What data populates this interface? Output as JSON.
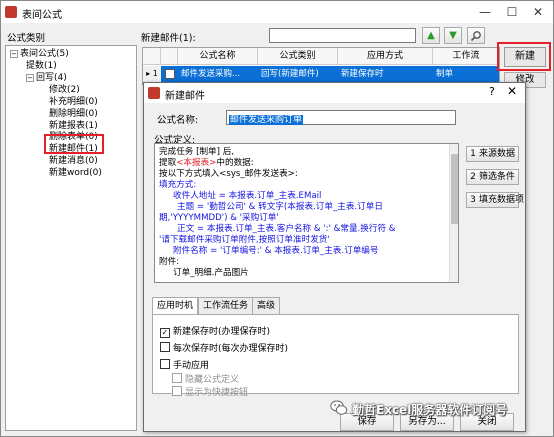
{
  "app": {
    "title": "表间公式"
  },
  "left": {
    "category_label": "公式类别",
    "tree": [
      {
        "label": "表间公式(5)",
        "level": 0,
        "expanded": true
      },
      {
        "label": "提数(1)",
        "level": 1
      },
      {
        "label": "回写(4)",
        "level": 1,
        "expanded": true
      },
      {
        "label": "修改(2)",
        "level": 2
      },
      {
        "label": "补充明细(0)",
        "level": 2
      },
      {
        "label": "删除明细(0)",
        "level": 2
      },
      {
        "label": "新建报表(1)",
        "level": 2
      },
      {
        "label": "删除表单(0)",
        "level": 2
      },
      {
        "label": "新建邮件(1)",
        "level": 2,
        "selected": true
      },
      {
        "label": "新建消息(0)",
        "level": 2
      },
      {
        "label": "新建word(0)",
        "level": 2
      }
    ]
  },
  "top": {
    "list_label": "新建邮件(1):",
    "search": {
      "value": "",
      "placeholder": ""
    },
    "up_icon": "arrow-up-icon",
    "down_icon": "arrow-down-icon",
    "find_icon": "magnifier-icon"
  },
  "grid": {
    "columns": [
      "公式名称",
      "公式类别",
      "应用方式",
      "工作流"
    ],
    "rows": [
      {
        "indicator": "▸ 1",
        "name": "邮件发送采购...",
        "category": "回写(新建邮件)",
        "apply": "新建保存时",
        "workflow": "制单"
      }
    ]
  },
  "buttons": {
    "new": "新建",
    "edit": "修改"
  },
  "dialog": {
    "title": "新建邮件",
    "help": "?",
    "close": "✕",
    "name_label": "公式名称:",
    "name_value": "邮件发送采购订单",
    "def_label": "公式定义:",
    "definition": {
      "l1": "完成任务 [制单] 后,",
      "l2_a": "提取",
      "l2_b": "<本报表>",
      "l2_c": "中的数据:",
      "l3": "按以下方式填入<sys_邮件发送表>:",
      "l4": "填充方式:",
      "l5": "收件人地址 = 本报表.订单_主表.EMail",
      "l6": "主题 = '勤哲公司' & 转文字(本报表.订单_主表.订单日",
      "l7": "期,'YYYYMMDD') & '采购订单'",
      "l8": "正文 = 本报表.订单_主表.客户名称 & ':' &常量.换行符 &",
      "l9": "'请下载邮件采购订单附件,按照订单准时发货'",
      "l10": "附件名称 = '订单编号:' & 本报表.订单_主表.订单编号",
      "l11": "附件:",
      "l12": "订单_明细.产品图片"
    },
    "side_buttons": [
      {
        "num": "1",
        "label": "来源数据"
      },
      {
        "num": "2",
        "label": "筛选条件"
      },
      {
        "num": "3",
        "label": "填充数据项"
      }
    ],
    "tabs": [
      "应用时机",
      "工作流任务",
      "高级"
    ],
    "options": {
      "new_save": {
        "label": "新建保存时(办理保存时)",
        "checked": true
      },
      "every_save": {
        "label": "每次保存时(每次办理保存时)",
        "checked": false
      },
      "manual": {
        "label": "手动应用",
        "checked": false
      },
      "hide_def": {
        "label": "隐藏公式定义",
        "checked": false
      },
      "show_quick": {
        "label": "显示为快捷按钮",
        "checked": false
      }
    },
    "footer": {
      "save": "保存",
      "save_as": "另存为...",
      "close": "关闭"
    }
  },
  "watermark": {
    "text": "勤哲Excel服务器软件订阅号",
    "icon": "wechat-icon"
  },
  "colors": {
    "accent": "#0a6fd6",
    "highlight": "#e5202a",
    "keyword": "#1515e0"
  }
}
